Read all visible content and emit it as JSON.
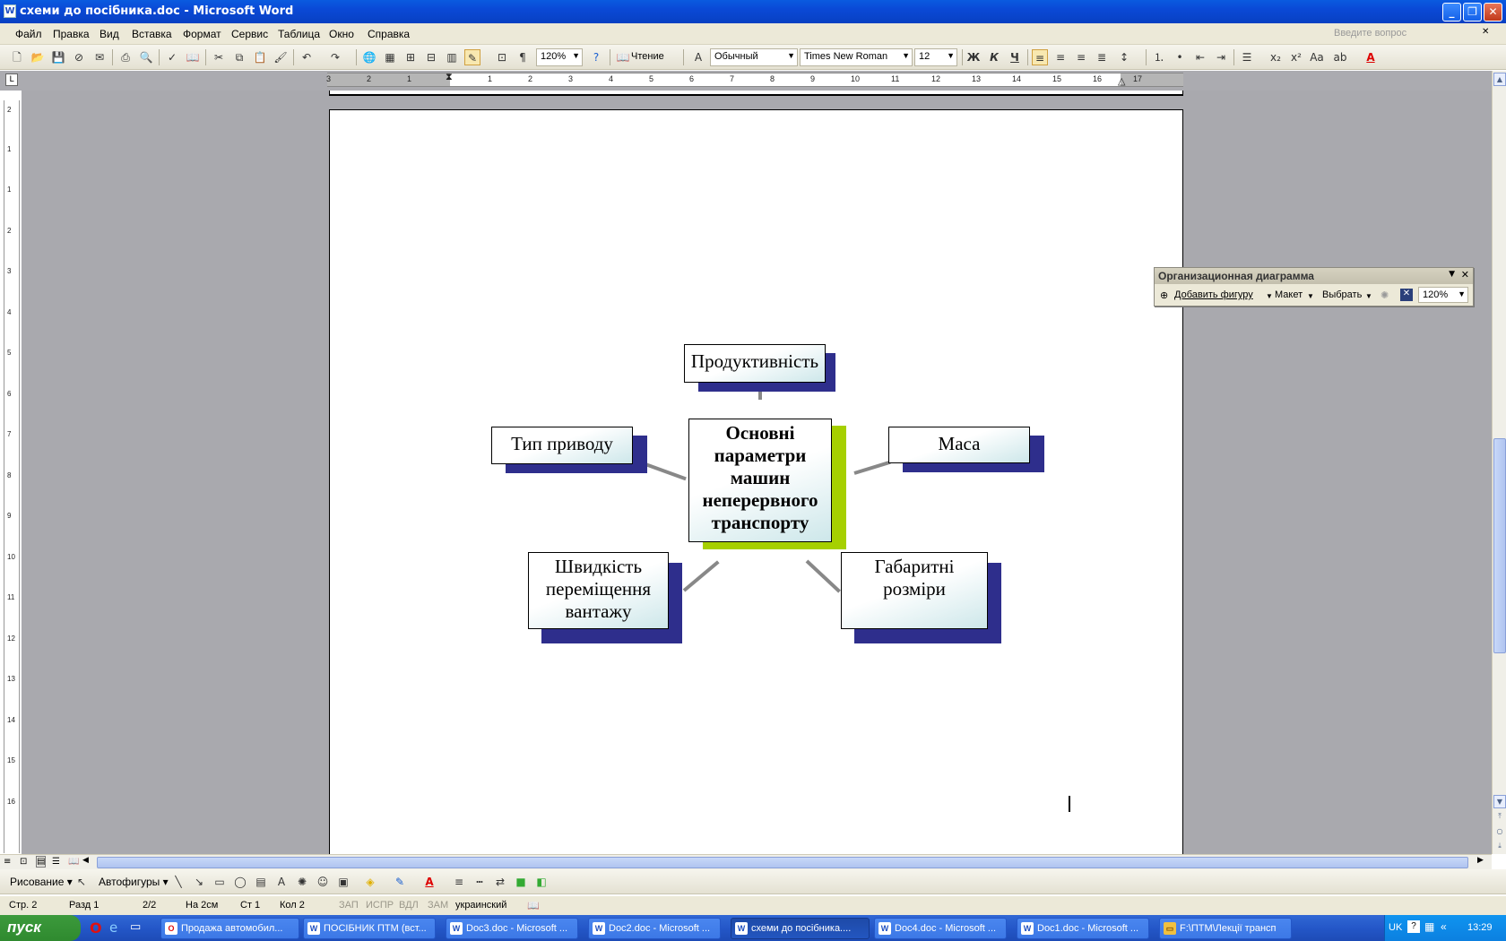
{
  "window": {
    "title": "схеми до посібника.doc - Microsoft Word"
  },
  "menu": {
    "items": [
      "Файл",
      "Правка",
      "Вид",
      "Вставка",
      "Формат",
      "Сервис",
      "Таблица",
      "Окно",
      "Справка"
    ],
    "ask_placeholder": "Введите вопрос"
  },
  "toolbar": {
    "zoom": "120%",
    "read": "Чтение",
    "style": "Обычный",
    "font": "Times New Roman",
    "size": "12"
  },
  "orgchart_toolbar": {
    "title": "Организационная диаграмма",
    "add_shape": "Добавить фигуру",
    "layout": "Макет",
    "select": "Выбрать",
    "zoom": "120%"
  },
  "diagram": {
    "center": "Основні параметри машин неперервного транспорту",
    "top": "Продуктивність",
    "left": "Тип приводу",
    "right": "Маса",
    "bottom_left": "Швидкість переміщення вантажу",
    "bottom_right": "Габаритні розміри"
  },
  "drawing_toolbar": {
    "draw": "Рисование",
    "autoshapes": "Автофигуры"
  },
  "status": {
    "page": "Стр. 2",
    "section": "Разд 1",
    "pages": "2/2",
    "at": "На 2см",
    "line": "Ст 1",
    "col": "Кол 2",
    "rec": "ЗАП",
    "trk": "ИСПР",
    "ext": "ВДЛ",
    "ovr": "ЗАМ",
    "lang": "украинский"
  },
  "taskbar": {
    "start": "пуск",
    "tasks": [
      "Продажа автомобил...",
      "ПОСІБНИК ПТМ (вст...",
      "Doc3.doc - Microsoft ...",
      "Doc2.doc - Microsoft ...",
      "схеми до посібника....",
      "Doc4.doc - Microsoft ...",
      "Doc1.doc - Microsoft ...",
      "F:\\ПТМ\\Лекції трансп"
    ],
    "lang": "UK",
    "clock": "13:29"
  },
  "ruler": {
    "h": [
      "3",
      "2",
      "1",
      "1",
      "2",
      "3",
      "4",
      "5",
      "6",
      "7",
      "8",
      "9",
      "10",
      "11",
      "12",
      "13",
      "14",
      "15",
      "16",
      "17"
    ],
    "v": [
      "2",
      "1",
      "1",
      "2",
      "3",
      "4",
      "5",
      "6",
      "7",
      "8",
      "9",
      "10",
      "11",
      "12",
      "13",
      "14",
      "15",
      "16"
    ]
  }
}
